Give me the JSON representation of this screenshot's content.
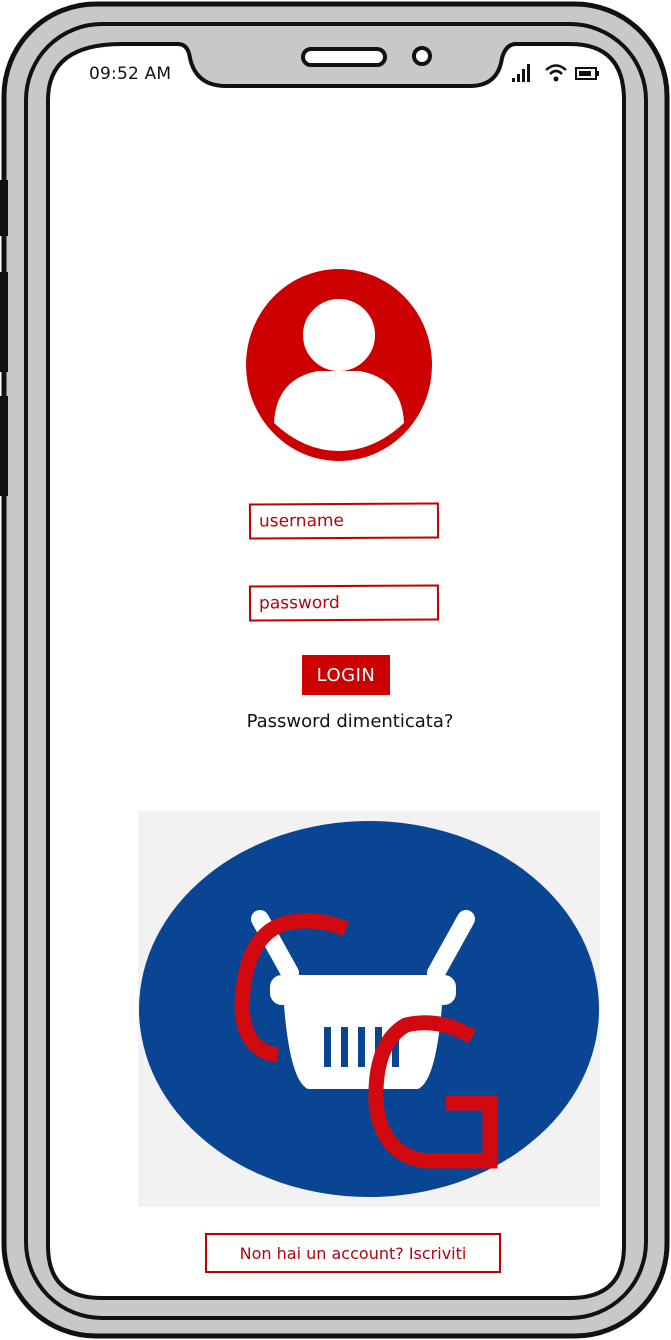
{
  "status_bar": {
    "time": "09:52 AM",
    "icons": [
      "signal-icon",
      "wifi-icon",
      "battery-icon"
    ]
  },
  "avatar": {
    "icon": "user-avatar-icon",
    "color": "#cc0000"
  },
  "login_form": {
    "username_placeholder": "username",
    "password_placeholder": "password",
    "login_label": "LOGIN",
    "forgot_password": "Password dimenticata?"
  },
  "logo": {
    "icon": "shopping-basket-icon",
    "letters": "CG",
    "colors": {
      "circle": "#0a4593",
      "letters": "#d20a10",
      "basket": "#ffffff",
      "background": "#f2f2f2"
    }
  },
  "signup": {
    "label": "Non hai un account? Iscriviti"
  },
  "colors": {
    "accent": "#cc0000",
    "frame": "#c8c8c8",
    "outline": "#111111"
  }
}
